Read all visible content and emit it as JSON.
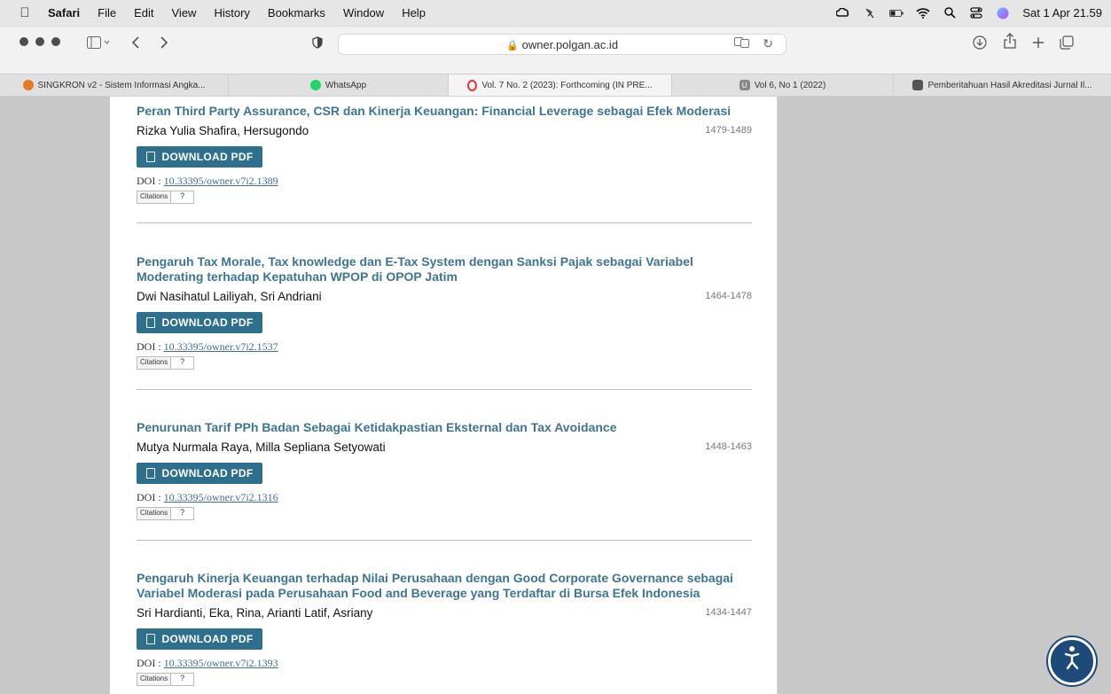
{
  "menubar": {
    "app": "Safari",
    "menus": [
      "File",
      "Edit",
      "View",
      "History",
      "Bookmarks",
      "Window",
      "Help"
    ],
    "clock": "Sat 1 Apr 21.59"
  },
  "toolbar": {
    "url": "owner.polgan.ac.id"
  },
  "tabs": [
    {
      "label": "SINGKRON v2 - Sistem Informasi Angka...",
      "favicon_color": "#e07b2a",
      "active": false
    },
    {
      "label": "WhatsApp",
      "favicon_color": "#25d366",
      "active": false
    },
    {
      "label": "Vol. 7 No. 2 (2023): Forthcoming (IN PRE...",
      "favicon_color": "#e53935",
      "active": true
    },
    {
      "label": "Vol 6, No 1 (2022)",
      "favicon_color": "#888888",
      "active": false
    },
    {
      "label": "Pemberitahuan Hasil Akreditasi Jurnal Il...",
      "favicon_color": "#555555",
      "active": false
    }
  ],
  "articles": [
    {
      "title": "Peran Third Party Assurance, CSR dan Kinerja Keuangan: Financial Leverage sebagai Efek Moderasi",
      "authors": "Rizka Yulia Shafira, Hersugondo",
      "pages": "1479-1489",
      "download_label": "DOWNLOAD PDF",
      "doi_prefix": "DOI : ",
      "doi": "10.33395/owner.v7i2.1389",
      "citations_label": "Citations",
      "citations_count": "?"
    },
    {
      "title": "Pengaruh Tax Morale, Tax knowledge dan E-Tax System dengan Sanksi Pajak sebagai Variabel Moderating terhadap Kepatuhan WPOP di OPOP Jatim",
      "authors": "Dwi Nasihatul Lailiyah, Sri Andriani",
      "pages": "1464-1478",
      "download_label": "DOWNLOAD PDF",
      "doi_prefix": "DOI : ",
      "doi": "10.33395/owner.v7i2.1537",
      "citations_label": "Citations",
      "citations_count": "?"
    },
    {
      "title": "Penurunan Tarif PPh Badan Sebagai Ketidakpastian Eksternal dan Tax Avoidance",
      "authors": "Mutya Nurmala Raya, Milla Sepliana Setyowati",
      "pages": "1448-1463",
      "download_label": "DOWNLOAD PDF",
      "doi_prefix": "DOI : ",
      "doi": "10.33395/owner.v7i2.1316",
      "citations_label": "Citations",
      "citations_count": "?"
    },
    {
      "title": "Pengaruh Kinerja Keuangan terhadap Nilai Perusahaan dengan Good Corporate Governance sebagai Variabel Moderasi pada Perusahaan Food and Beverage yang Terdaftar di Bursa Efek Indonesia",
      "authors": "Sri Hardianti, Eka, Rina, Arianti Latif, Asriany",
      "pages": "1434-1447",
      "download_label": "DOWNLOAD PDF",
      "doi_prefix": "DOI : ",
      "doi": "10.33395/owner.v7i2.1393",
      "citations_label": "Citations",
      "citations_count": "?"
    }
  ]
}
